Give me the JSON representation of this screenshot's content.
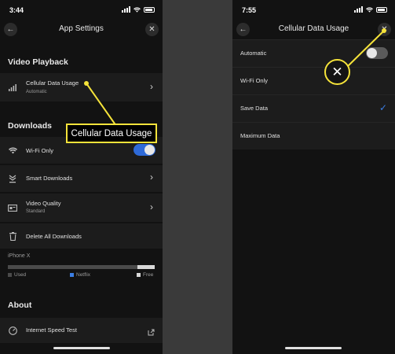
{
  "left": {
    "status_time": "3:44",
    "nav": {
      "back_icon": "chevron-left-icon",
      "title": "App Settings",
      "close_icon": "close-icon"
    },
    "video_playback": {
      "heading": "Video Playback",
      "cellular": {
        "label": "Cellular Data Usage",
        "sublabel": "Automatic",
        "icon": "cellular-bars-icon"
      }
    },
    "downloads": {
      "heading": "Downloads",
      "wifi_only": {
        "label": "Wi-Fi Only",
        "icon": "wifi-icon",
        "toggle_on": true,
        "toggle_color": "#2e6ad8"
      },
      "smart_downloads": {
        "label": "Smart Downloads",
        "icon": "smart-downloads-icon"
      },
      "video_quality": {
        "label": "Video Quality",
        "sublabel": "Standard",
        "icon": "video-quality-icon"
      },
      "delete_all": {
        "label": "Delete All Downloads",
        "icon": "trash-icon"
      }
    },
    "storage": {
      "device": "iPhone X",
      "legend_used": "Used",
      "legend_netflix": "Netflix",
      "legend_free": "Free",
      "used_color": "#4a4a4a",
      "netflix_color": "#3b7ee3",
      "free_color": "#d8d8d8"
    },
    "about": {
      "heading": "About",
      "speed_test": {
        "label": "Internet Speed Test",
        "icon": "speed-gauge-icon",
        "trailing_icon": "external-link-icon"
      }
    },
    "callout": {
      "text": "Cellular Data Usage",
      "color": "#f5e33a"
    }
  },
  "right": {
    "status_time": "7:55",
    "nav": {
      "back_icon": "chevron-left-icon",
      "title": "Cellular Data Usage",
      "close_icon": "close-icon"
    },
    "options": [
      {
        "label": "Automatic",
        "control": "toggle",
        "toggle_on": false
      },
      {
        "label": "Wi-Fi Only",
        "control": "none"
      },
      {
        "label": "Save Data",
        "control": "check",
        "checked": true
      },
      {
        "label": "Maximum Data",
        "control": "none"
      }
    ],
    "callout_icon": "close-icon"
  }
}
